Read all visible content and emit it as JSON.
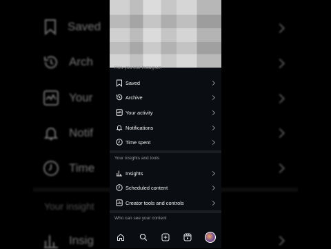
{
  "background": {
    "items": [
      {
        "label": "Saved",
        "icon": "bookmark-icon"
      },
      {
        "label": "Arch",
        "icon": "archive-icon"
      },
      {
        "label": "Your",
        "icon": "activity-icon"
      },
      {
        "label": "Notif",
        "icon": "bell-icon"
      },
      {
        "label": "Time",
        "icon": "clock-icon"
      }
    ],
    "heading": "Your insight",
    "bottom_item": {
      "label": "Insig",
      "icon": "insights-icon"
    }
  },
  "screen": {
    "faded_heading": "How you use Instagram",
    "usage_items": [
      {
        "label": "Saved",
        "icon": "bookmark-icon"
      },
      {
        "label": "Archive",
        "icon": "archive-icon"
      },
      {
        "label": "Your activity",
        "icon": "activity-icon"
      },
      {
        "label": "Notifications",
        "icon": "bell-icon"
      },
      {
        "label": "Time spent",
        "icon": "clock-icon"
      }
    ],
    "insights_heading": "Your insights and tools",
    "insight_items": [
      {
        "label": "Insights",
        "icon": "insights-icon"
      },
      {
        "label": "Scheduled content",
        "icon": "scheduled-icon"
      },
      {
        "label": "Creator tools and controls",
        "icon": "creator-tools-icon"
      }
    ],
    "visibility_heading": "Who can see your content",
    "bottom_nav": [
      {
        "name": "home",
        "icon": "home-icon"
      },
      {
        "name": "search",
        "icon": "search-icon"
      },
      {
        "name": "create",
        "icon": "plus-square-icon"
      },
      {
        "name": "reels",
        "icon": "reels-icon"
      },
      {
        "name": "profile",
        "icon": "avatar"
      }
    ]
  },
  "colors": {
    "background": "#000000",
    "screen": "#0a0d12",
    "text": "#f0f0f0",
    "muted": "#9a9a9a"
  }
}
